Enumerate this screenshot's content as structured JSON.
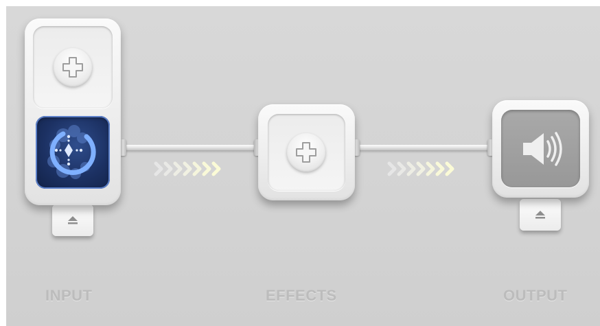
{
  "pipeline": {
    "input_label": "INPUT",
    "effects_label": "EFFECTS",
    "output_label": "OUTPUT"
  },
  "icons": {
    "add": "plus-icon",
    "input_source": "radial-dots-icon",
    "eject": "eject-icon",
    "output_device": "speaker-icon",
    "flow": "chevron-arrows-icon"
  },
  "colors": {
    "input_source_bg": "#1c3163",
    "input_source_accent": "#6f9cf0",
    "output_slot_bg": "#9e9e9e",
    "label_text": "#bcbcbc"
  }
}
